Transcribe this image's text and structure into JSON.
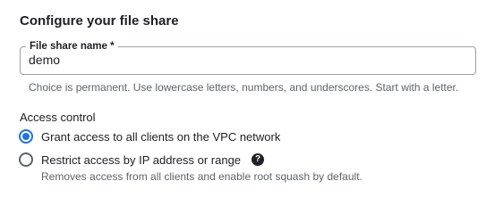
{
  "section": {
    "title": "Configure your file share"
  },
  "file_share_name": {
    "label": "File share name *",
    "value": "demo",
    "helper": "Choice is permanent. Use lowercase letters, numbers, and underscores. Start with a letter."
  },
  "access_control": {
    "title": "Access control",
    "options": [
      {
        "label": "Grant access to all clients on the VPC network",
        "selected": true
      },
      {
        "label": "Restrict access by IP address or range",
        "selected": false,
        "description": "Removes access from all clients and enable root squash by default.",
        "help_icon": "question-icon",
        "help_glyph": "?"
      }
    ]
  },
  "colors": {
    "accent": "#1a73e8",
    "text": "#202124",
    "muted": "#5f6368",
    "border": "#9aa0a6"
  }
}
